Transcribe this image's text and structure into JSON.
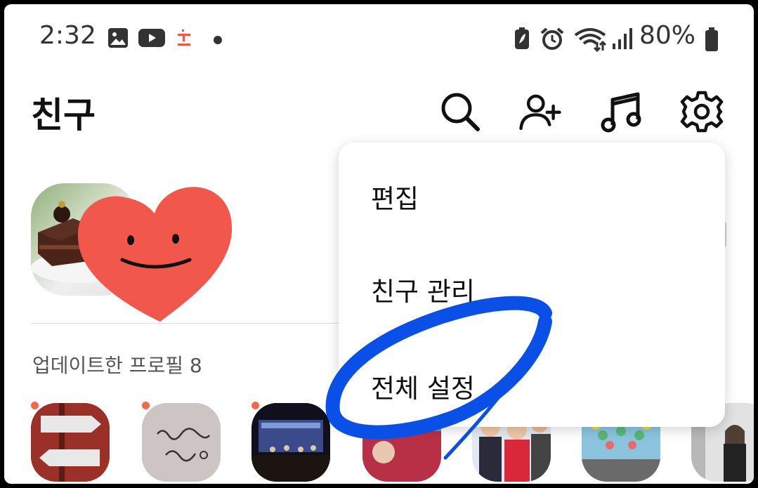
{
  "status_bar": {
    "time": "2:32",
    "battery": "80%",
    "icons_left": [
      "gallery-icon",
      "youtube-icon",
      "t-app-icon",
      "notification-dot"
    ],
    "icons_right": [
      "battery-saver-icon",
      "alarm-icon",
      "wifi-icon",
      "signal-icon",
      "battery-icon"
    ]
  },
  "header": {
    "title": "친구",
    "actions": [
      "search-icon",
      "add-friend-icon",
      "music-icon",
      "settings-icon"
    ]
  },
  "profile": {
    "sticker": "heart-smile-sticker"
  },
  "updated_profiles": {
    "label": "업데이트한 프로필 8"
  },
  "dropdown_menu": {
    "items": [
      "편집",
      "친구 관리",
      "전체 설정"
    ],
    "highlighted": "전체 설정"
  },
  "colors": {
    "accent_dot": "#ee6a4b",
    "heart": "#f2574c",
    "annotation": "#0a4fe6"
  }
}
